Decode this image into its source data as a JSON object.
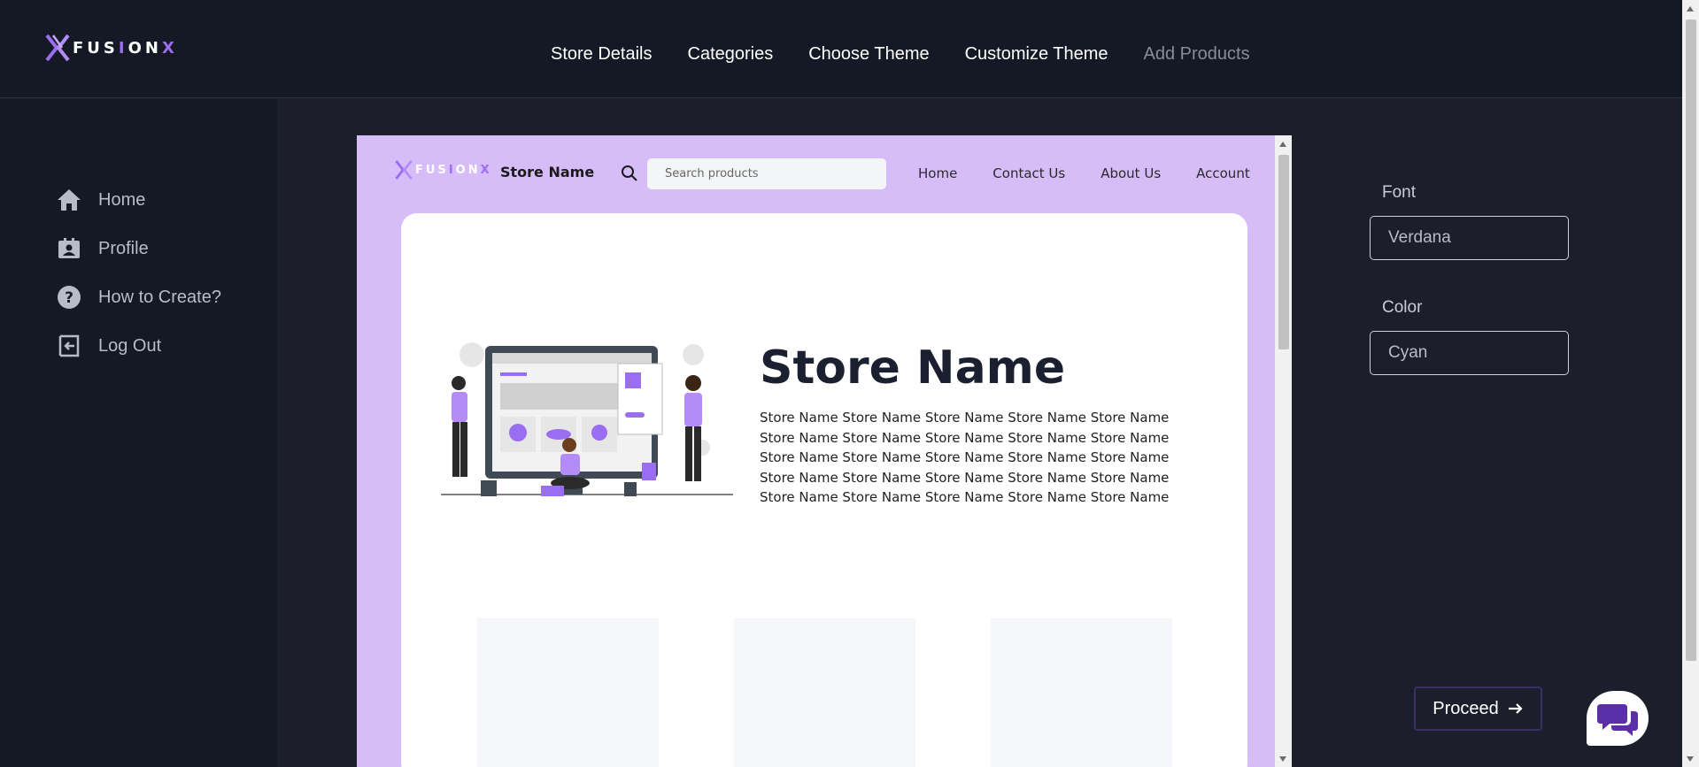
{
  "brand": {
    "logo_prefix": "FUS",
    "logo_mid": "I",
    "logo_rest": "ON",
    "logo_suffix": "X"
  },
  "topnav": [
    {
      "label": "Store Details",
      "active": true
    },
    {
      "label": "Categories",
      "active": true
    },
    {
      "label": "Choose Theme",
      "active": true
    },
    {
      "label": "Customize Theme",
      "active": true
    },
    {
      "label": "Add Products",
      "active": false
    }
  ],
  "sidebar": {
    "items": [
      {
        "label": "Home",
        "icon": "home-icon"
      },
      {
        "label": "Profile",
        "icon": "profile-card-icon"
      },
      {
        "label": "How to Create?",
        "icon": "help-icon"
      },
      {
        "label": "Log Out",
        "icon": "logout-icon"
      }
    ]
  },
  "preview": {
    "store_name": "Store Name",
    "search_placeholder": "Search products",
    "nav": [
      "Home",
      "Contact Us",
      "About Us",
      "Account"
    ],
    "hero_title": "Store Name",
    "hero_lines": [
      "Store Name Store Name Store Name Store Name Store Name",
      "Store Name Store Name Store Name Store Name Store Name",
      "Store Name Store Name Store Name Store Name Store Name",
      "Store Name Store Name Store Name Store Name Store Name",
      "Store Name Store Name Store Name Store Name Store Name"
    ]
  },
  "settings": {
    "font_label": "Font",
    "font_value": "Verdana",
    "color_label": "Color",
    "color_value": "Cyan"
  },
  "actions": {
    "proceed_label": "Proceed",
    "proceed_icon": "arrow-right-icon",
    "chat_icon": "chat-icon"
  },
  "colors": {
    "accent": "#9b6df0",
    "preview_bg": "#d7bdf8",
    "app_bg": "#1c1f2b",
    "panel_bg": "#151925"
  }
}
